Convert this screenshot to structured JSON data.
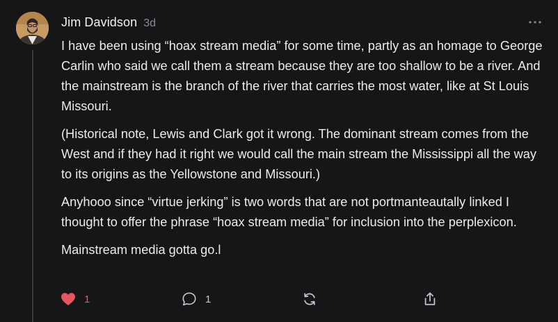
{
  "comment": {
    "author": "Jim Davidson",
    "timestamp": "3d",
    "paragraphs": [
      "I have been using “hoax stream media” for some time, partly as an homage to George Carlin who said we call them a stream because they are too shallow to be a river. And the mainstream is the branch of the river that carries the most water, like at St Louis Missouri.",
      "(Historical note, Lewis and Clark got it wrong. The dominant stream comes from the West and if they had it right we would call the main stream the Mississippi all the way to its origins as the Yellowstone and Missouri.)",
      "Anyhooo since “virtue jerking” is two words that are not portmanteautally linked I thought to offer the phrase “hoax stream media” for inclusion into the perplexicon.",
      "Mainstream media gotta go.l"
    ]
  },
  "actions": {
    "like": {
      "icon": "heart-icon",
      "count": "1",
      "active": true,
      "color": "#e4575c"
    },
    "reply": {
      "icon": "speech-bubble-icon",
      "count": "1"
    },
    "restack": {
      "icon": "restack-icon"
    },
    "share": {
      "icon": "share-icon"
    }
  },
  "menu": {
    "icon": "ellipsis-icon"
  },
  "theme": {
    "background": "#161618",
    "text": "#ebebed",
    "muted": "#8b8b90",
    "thread_line": "#3a3a3d"
  }
}
